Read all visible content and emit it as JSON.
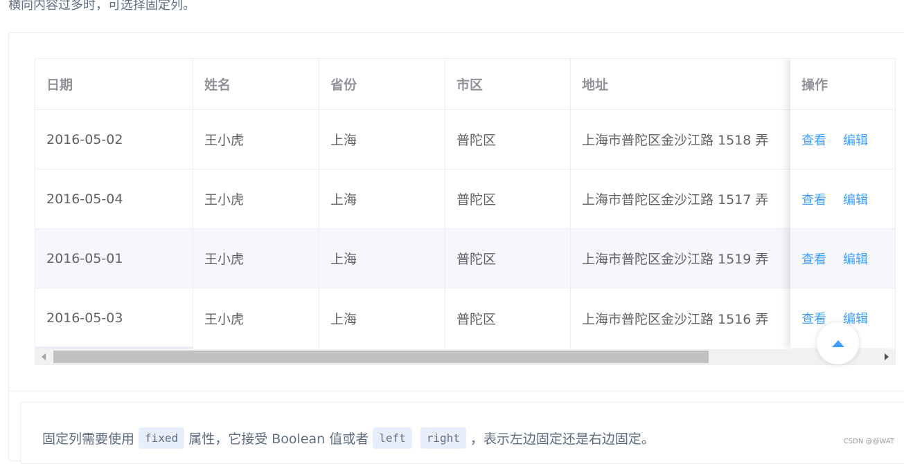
{
  "intro_text": "横向内容过多时，可选择固定列。",
  "table": {
    "headers": {
      "date": "日期",
      "name": "姓名",
      "province": "省份",
      "city": "市区",
      "address": "地址",
      "ops": "操作"
    },
    "rows": [
      {
        "date": "2016-05-02",
        "name": "王小虎",
        "province": "上海",
        "city": "普陀区",
        "address": "上海市普陀区金沙江路 1518 弄"
      },
      {
        "date": "2016-05-04",
        "name": "王小虎",
        "province": "上海",
        "city": "普陀区",
        "address": "上海市普陀区金沙江路 1517 弄"
      },
      {
        "date": "2016-05-01",
        "name": "王小虎",
        "province": "上海",
        "city": "普陀区",
        "address": "上海市普陀区金沙江路 1519 弄"
      },
      {
        "date": "2016-05-03",
        "name": "王小虎",
        "province": "上海",
        "city": "普陀区",
        "address": "上海市普陀区金沙江路 1516 弄"
      }
    ],
    "view_label": "查看",
    "edit_label": "编辑"
  },
  "description": {
    "part1": "固定列需要使用",
    "code1": "fixed",
    "part2": "属性，它接受 Boolean 值或者",
    "code2": "left",
    "code3": "right",
    "part3": "，表示左边固定还是右边固定。"
  },
  "watermark": "CSDN @@WAT",
  "colors": {
    "link": "#409eff",
    "header_text": "#909399",
    "body_text": "#606266",
    "border": "#ebeef5",
    "stripe": "#f5f7fa"
  },
  "icons": {
    "backtop": "caret-up-icon",
    "scroll_left": "scroll-left-arrow-icon",
    "scroll_right": "scroll-right-arrow-icon"
  }
}
